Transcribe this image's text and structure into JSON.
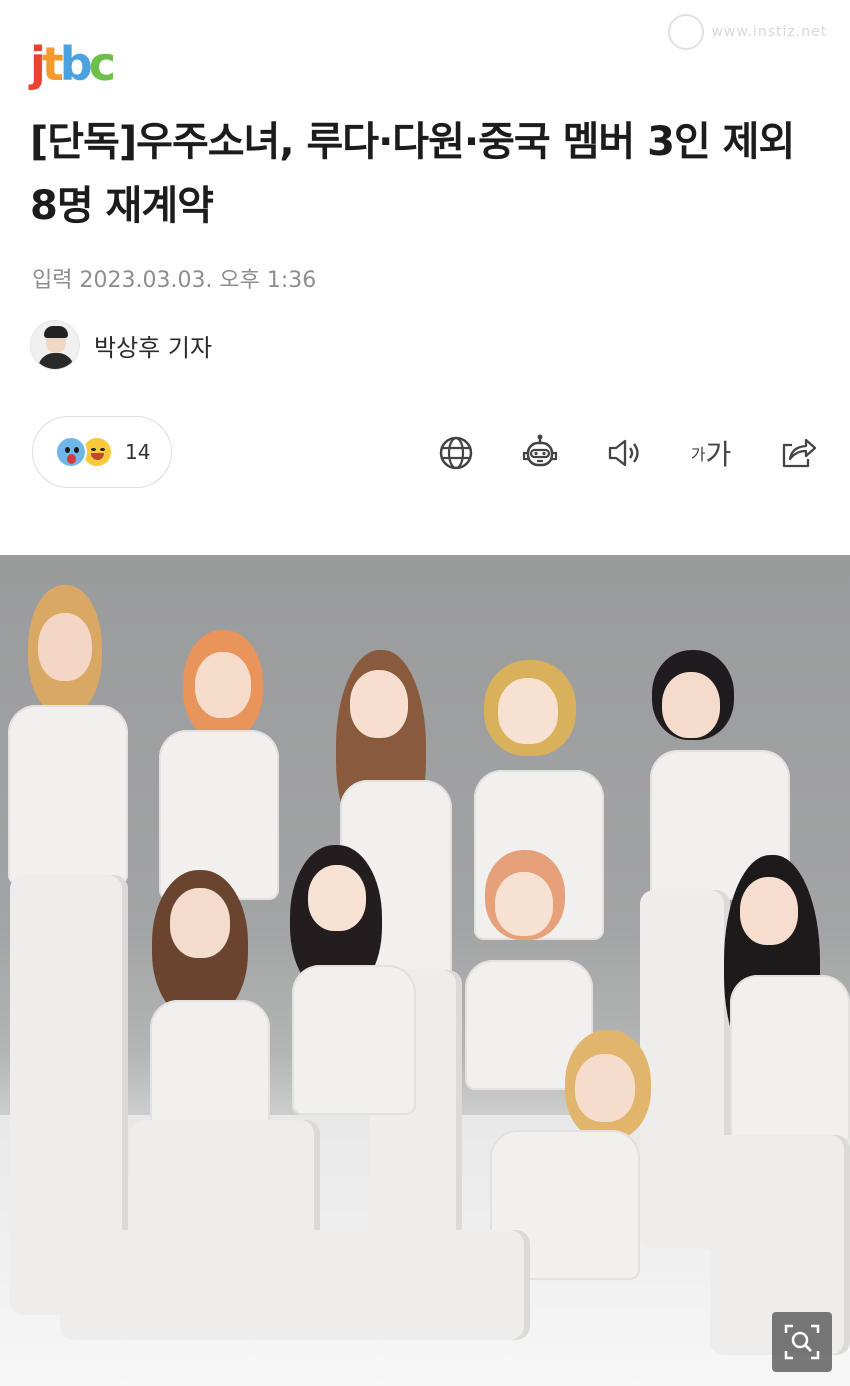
{
  "header": {
    "logo_text": [
      "j",
      "t",
      "b",
      "c"
    ],
    "logo_colors": [
      "#e8432e",
      "#f29a2e",
      "#4aa3df",
      "#6cc04a"
    ],
    "watermark_text": "www.instiz.net"
  },
  "article": {
    "title": "[단독]우주소녀, 루다·다원·중국 멤버 3인 제외 8명 재계약",
    "date": "입력 2023.03.03. 오후 1:36",
    "author": "박상후 기자"
  },
  "reactions": {
    "count": "14",
    "emojis": [
      "shocked-face-icon",
      "smiling-face-icon"
    ]
  },
  "toolbar": {
    "icons": [
      "globe-icon",
      "robot-icon",
      "speaker-icon",
      "font-size-icon",
      "share-icon"
    ],
    "font_size_small": "가",
    "font_size_large": "가"
  },
  "photo": {
    "description_icon": "zoom-icon"
  }
}
